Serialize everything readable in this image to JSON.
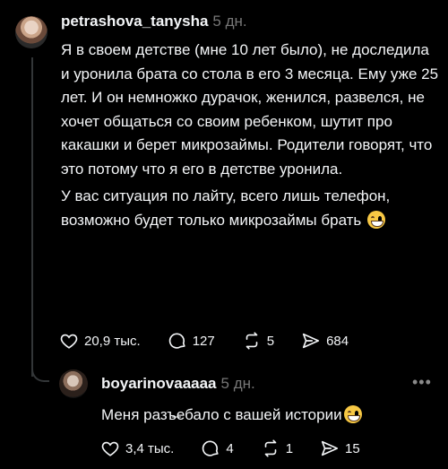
{
  "post": {
    "username": "petrashova_tanysha",
    "time": "5 дн.",
    "paragraphs": [
      "Я в своем детстве (мне 10 лет было), не доследила и уронила брата со стола в его 3 месяца. Ему уже 25 лет. И он немножко дурачок, женился, развелся, не хочет общаться со своим ребенком, шутит про какашки и берет микрозаймы. Родители говорят, что это потому что я его в детстве уронила.",
      "У вас ситуация по лайту, всего лишь телефон, возможно будет только микрозаймы брать"
    ],
    "emoji": "grinning-face-with-sweat",
    "likes": "20,9 тыс.",
    "comments": "127",
    "reposts": "5",
    "shares": "684"
  },
  "reply": {
    "username": "boyarinovaaaaa",
    "time": "5 дн.",
    "text": "Меня разъ̶ебало с вашей истории",
    "emoji": "face-with-tears-of-joy",
    "likes": "3,4 тыс.",
    "comments": "4",
    "reposts": "1",
    "shares": "15",
    "more_icon": "ellipsis-icon"
  },
  "colors": {
    "background": "#000000",
    "text": "#f3f5f7",
    "muted": "#777777",
    "line": "#333638"
  }
}
